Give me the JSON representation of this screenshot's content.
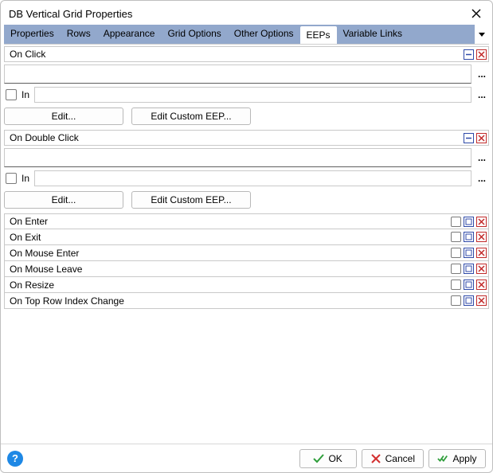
{
  "window": {
    "title": "DB Vertical Grid Properties"
  },
  "tabs": [
    {
      "label": "Properties",
      "active": false
    },
    {
      "label": "Rows",
      "active": false
    },
    {
      "label": "Appearance",
      "active": false
    },
    {
      "label": "Grid Options",
      "active": false
    },
    {
      "label": "Other Options",
      "active": false
    },
    {
      "label": "EEPs",
      "active": true
    },
    {
      "label": "Variable Links",
      "active": false
    }
  ],
  "expanded_events": [
    {
      "title": "On Click",
      "value": "",
      "in_checked": false,
      "in_label": "In",
      "in_value": "",
      "edit_label": "Edit...",
      "custom_label": "Edit Custom EEP..."
    },
    {
      "title": "On Double Click",
      "value": "",
      "in_checked": false,
      "in_label": "In",
      "in_value": "",
      "edit_label": "Edit...",
      "custom_label": "Edit Custom EEP..."
    }
  ],
  "collapsed_events": [
    {
      "title": "On Enter"
    },
    {
      "title": "On Exit"
    },
    {
      "title": "On Mouse Enter"
    },
    {
      "title": "On Mouse Leave"
    },
    {
      "title": "On Resize"
    },
    {
      "title": "On Top Row Index Change"
    }
  ],
  "footer": {
    "ok": "OK",
    "cancel": "Cancel",
    "apply": "Apply"
  },
  "icons": {
    "ellipsis": "..."
  },
  "help_glyph": "?"
}
